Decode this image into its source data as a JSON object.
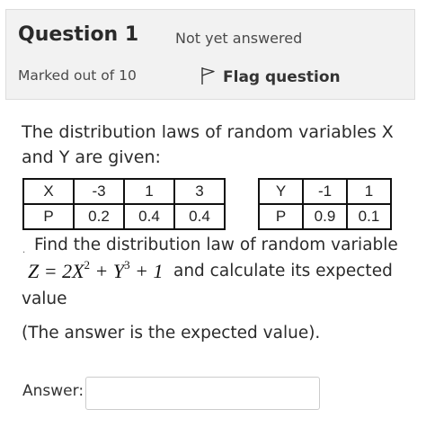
{
  "question": {
    "title": "Question 1",
    "state": "Not yet answered",
    "marks": "Marked out of 10",
    "flag_label": "Flag question",
    "flag_icon": "flag-icon"
  },
  "text": {
    "line1": "The distribution laws of random variables X",
    "line2": "and Y are given:",
    "line3": "Find the distribution law of random variable",
    "formula_a": "Z = 2X",
    "formula_exp1": "2",
    "formula_b": " + Y",
    "formula_exp2": "3",
    "formula_c": " + 1",
    "line4": "and calculate its expected",
    "line5": "value",
    "line6": "(The answer is the expected value)."
  },
  "table_x": {
    "rows": [
      [
        "X",
        "-3",
        "1",
        "3"
      ],
      [
        "P",
        "0.2",
        "0.4",
        "0.4"
      ]
    ]
  },
  "table_y": {
    "rows": [
      [
        "Y",
        "-1",
        "1"
      ],
      [
        "P",
        "0.9",
        "0.1"
      ]
    ]
  },
  "answer": {
    "label": "Answer:",
    "value": ""
  }
}
